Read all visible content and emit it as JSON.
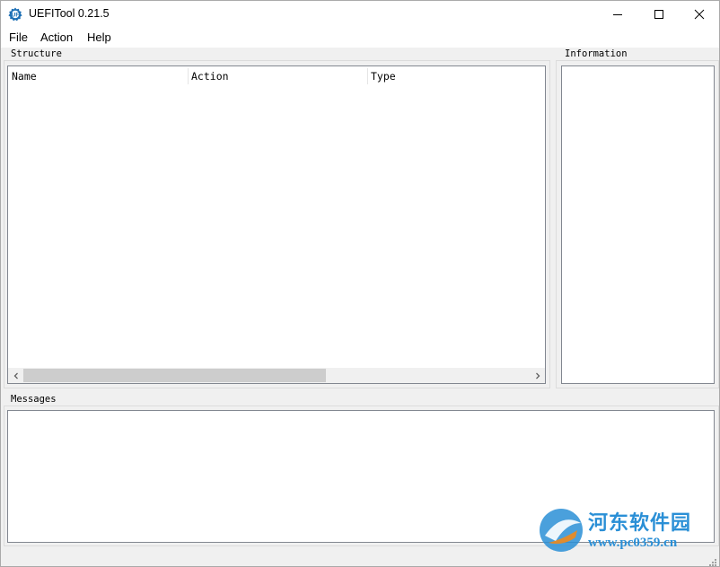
{
  "window": {
    "title": "UEFITool 0.21.5"
  },
  "menu": {
    "items": [
      "File",
      "Action",
      "Help"
    ]
  },
  "structure": {
    "label": "Structure",
    "columns": [
      "Name",
      "Action",
      "Type"
    ]
  },
  "information": {
    "label": "Information"
  },
  "messages": {
    "label": "Messages"
  },
  "watermark": {
    "title": "河东软件园",
    "url": "www.pc0359.cn"
  },
  "colors": {
    "watermark": "#2a8fd6",
    "app_icon": "#1c6fb5"
  },
  "icons": [
    "uefitool-app-icon",
    "minimize-icon",
    "maximize-icon",
    "close-icon",
    "scroll-left-icon",
    "scroll-right-icon",
    "size-grip-icon",
    "watermark-logo-icon"
  ]
}
